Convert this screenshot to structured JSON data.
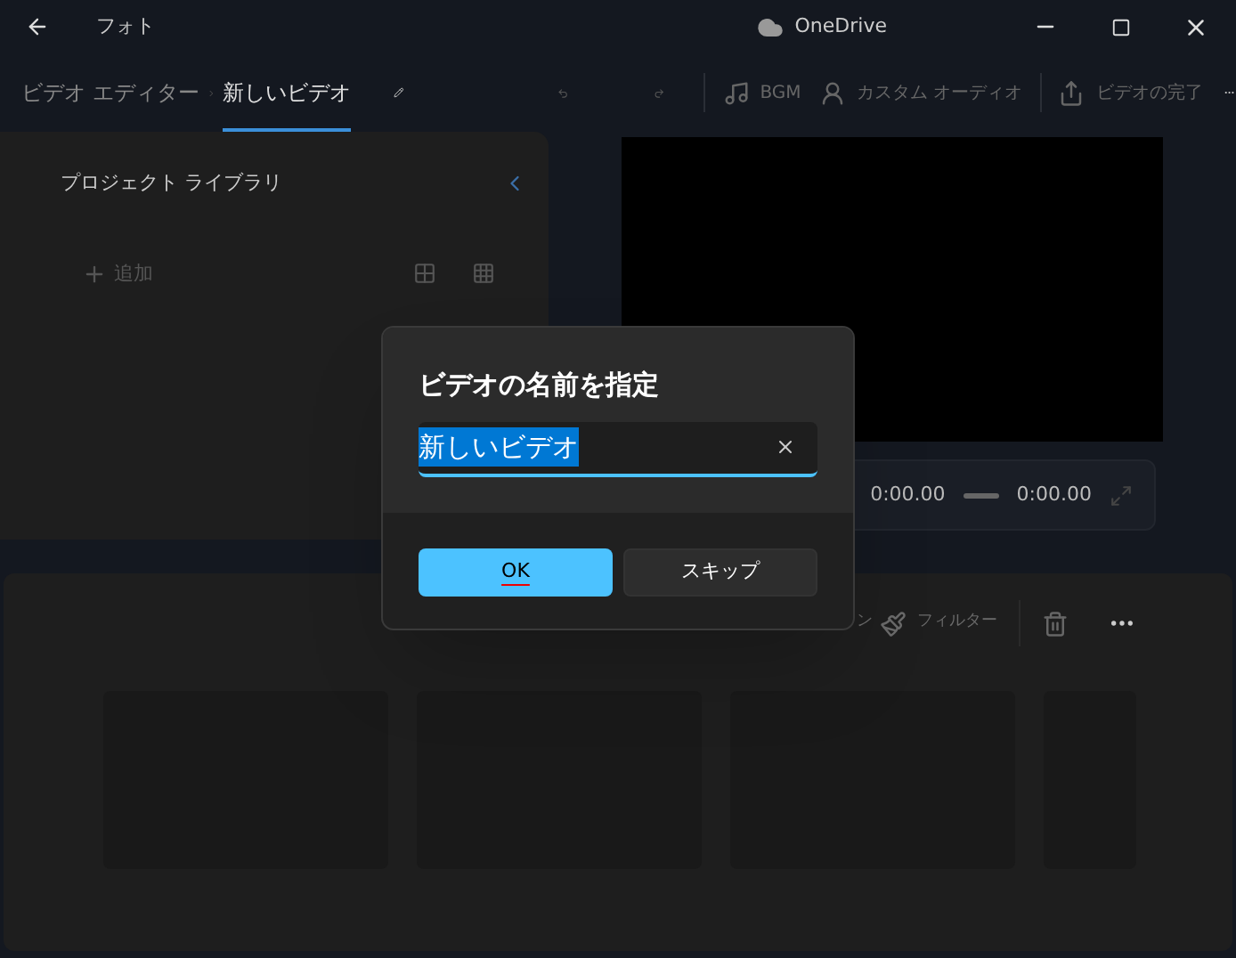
{
  "title_bar": {
    "app_name": "フォト",
    "account": "OneDrive"
  },
  "breadcrumb": [
    {
      "label": "ビデオ エディター",
      "selected": false
    },
    {
      "label": "新しいビデオ",
      "selected": true
    }
  ],
  "toolbar": [
    {
      "label": "BGM",
      "kind": "music"
    },
    {
      "label": "カスタム オーディオ",
      "kind": "audio"
    },
    {
      "label": "ビデオの完了",
      "kind": "share"
    }
  ],
  "library": {
    "title": "プロジェクト ライブラリ",
    "add": "追加"
  },
  "playback": {
    "current": "0:00.00",
    "total": "0:00.00"
  },
  "storyboard": {
    "tools": [
      {
        "label": "ン",
        "kind": "text"
      },
      {
        "label": "フィルター",
        "kind": "filter"
      }
    ],
    "cards": [
      {
        "kind": "clip"
      },
      {
        "kind": "clip"
      },
      {
        "kind": "clip"
      },
      {
        "kind": "clip"
      }
    ]
  },
  "dialog": {
    "title": "ビデオの名前を指定",
    "value": "新しいビデオ",
    "buttons": [
      {
        "label": "OK",
        "kind": "primary"
      },
      {
        "label": "スキップ",
        "kind": "secondary"
      }
    ]
  }
}
